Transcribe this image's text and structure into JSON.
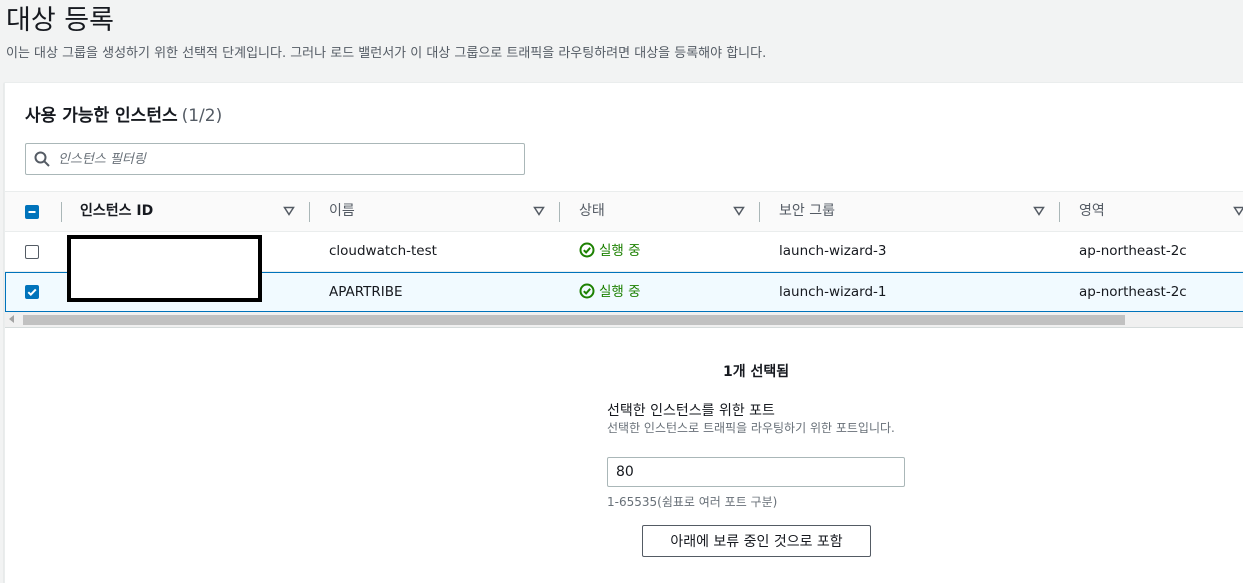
{
  "page": {
    "title": "대상 등록",
    "description": "이는 대상 그룹을 생성하기 위한 선택적 단계입니다. 그러나 로드 밸런서가 이 대상 그룹으로 트래픽을 라우팅하려면 대상을 등록해야 합니다."
  },
  "instances": {
    "title": "사용 가능한 인스턴스",
    "count": "(1/2)",
    "filter_placeholder": "인스턴스 필터링",
    "columns": [
      "인스턴스 ID",
      "이름",
      "상태",
      "보안 그룹",
      "영역"
    ],
    "rows": [
      {
        "name": "cloudwatch-test",
        "state": "실행 중",
        "security_group": "launch-wizard-3",
        "zone": "ap-northeast-2c",
        "selected": false
      },
      {
        "name": "APARTRIBE",
        "state": "실행 중",
        "security_group": "launch-wizard-1",
        "zone": "ap-northeast-2c",
        "selected": true
      }
    ]
  },
  "selection": {
    "count_label": "1개 선택됨",
    "port_label": "선택한 인스턴스를 위한 포트",
    "port_description": "선택한 인스턴스로 트래픽을 라우팅하기 위한 포트입니다.",
    "port_value": "80",
    "port_hint": "1-65535(쉼표로 여러 포트 구분)",
    "include_button": "아래에 보류 중인 것으로 포함"
  },
  "colors": {
    "accent": "#0073bb",
    "success": "#1d8102"
  }
}
